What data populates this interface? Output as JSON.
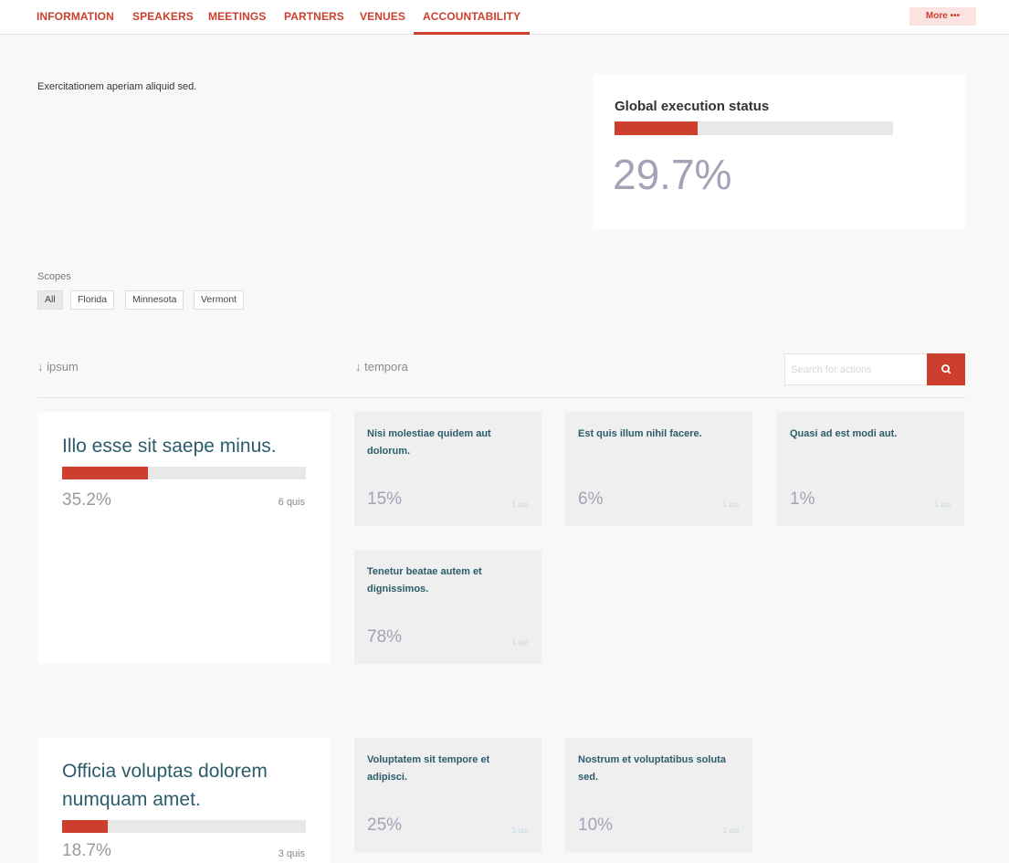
{
  "nav": {
    "items": [
      {
        "label": "INFORMATION",
        "active": false
      },
      {
        "label": "SPEAKERS",
        "active": false
      },
      {
        "label": "MEETINGS",
        "active": false
      },
      {
        "label": "PARTNERS",
        "active": false
      },
      {
        "label": "VENUES",
        "active": false
      },
      {
        "label": "ACCOUNTABILITY",
        "active": true
      }
    ],
    "more_label": "More •••"
  },
  "intro_text": "Exercitationem aperiam aliquid sed.",
  "global_status": {
    "title": "Global execution status",
    "value_label": "29.7%",
    "progress": 0.297
  },
  "scopes": {
    "label": "Scopes",
    "options": [
      "All",
      "Florida",
      "Minnesota",
      "Vermont"
    ],
    "selected": "All"
  },
  "sort_headers": [
    "↓ ipsum",
    "↓ tempora"
  ],
  "search": {
    "placeholder": "Search for actions",
    "value": ""
  },
  "colors": {
    "accent": "#cc3f2d",
    "title": "#2b5c6b",
    "value": "#a3a2b6",
    "page_bg": "#f8f8f8",
    "sub_card_bg": "#efefef"
  },
  "categories": [
    {
      "title": "Illo esse sit saepe minus.",
      "progress": 0.352,
      "percent": "35.2%",
      "count": "6 quis",
      "results": [
        {
          "title": "Nisi molestiae quidem aut dolorum.",
          "percent": "15%",
          "count": "1 qui"
        },
        {
          "title": "Est quis illum nihil facere.",
          "percent": "6%",
          "count": "1 qui"
        },
        {
          "title": "Quasi ad est modi aut.",
          "percent": "1%",
          "count": "1 qui"
        },
        {
          "title": "Tenetur beatae autem et dignissimos.",
          "percent": "78%",
          "count": "1 qui"
        }
      ]
    },
    {
      "title": "Officia voluptas dolorem numquam amet.",
      "progress": 0.187,
      "percent": "18.7%",
      "count": "3 quis",
      "results": [
        {
          "title": "Voluptatem sit tempore et adipisci.",
          "percent": "25%",
          "count": "1 qui"
        },
        {
          "title": "Nostrum et voluptatibus soluta sed.",
          "percent": "10%",
          "count": "1 qui"
        }
      ]
    }
  ]
}
